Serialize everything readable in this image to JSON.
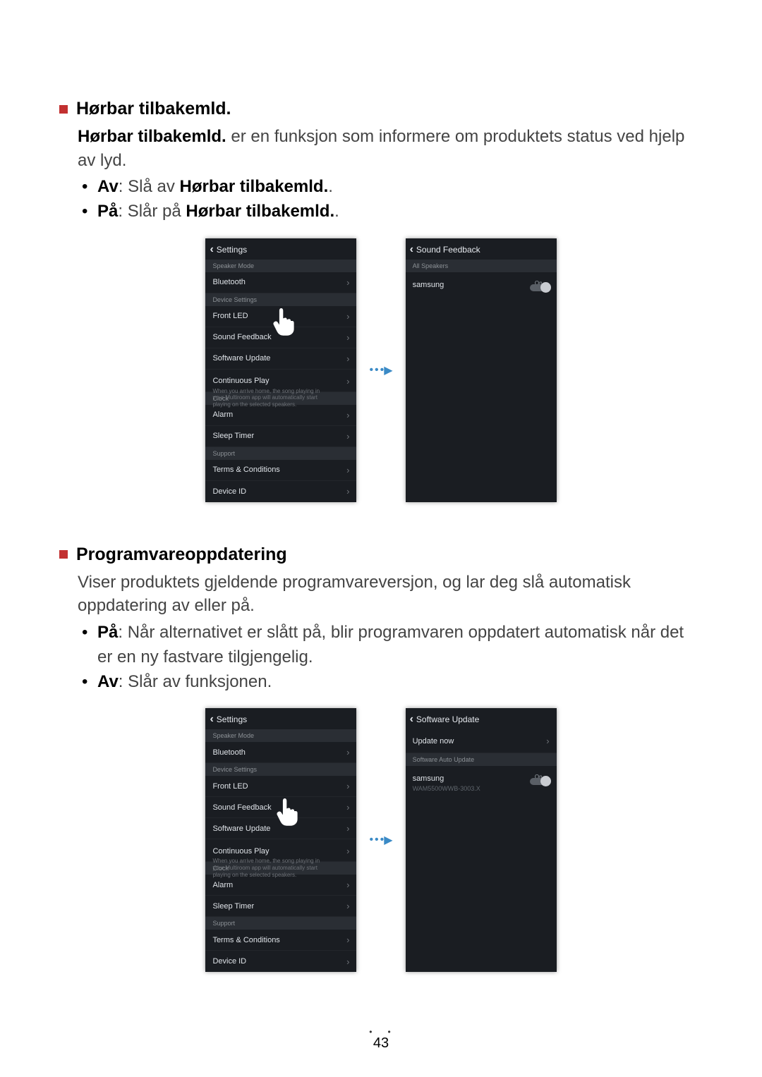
{
  "section1": {
    "heading": "Hørbar tilbakemld.",
    "intro_bold": "Hørbar tilbakemld.",
    "intro_rest": " er en funksjon som informere om produktets status ved hjelp av lyd.",
    "b1_label": "Av",
    "b1_text": ": Slå av ",
    "b1_bold2": "Hørbar tilbakemld.",
    "b1_end": ".",
    "b2_label": "På",
    "b2_text": ": Slår på ",
    "b2_bold2": "Hørbar tilbakemld.",
    "b2_end": "."
  },
  "section2": {
    "heading": "Programvareoppdatering",
    "intro": "Viser produktets gjeldende programvareversjon, og lar deg slå automatisk oppdatering av eller på.",
    "b1_label": "På",
    "b1_text": ": Når alternativet er slått på, blir programvaren oppdatert automatisk når det er en ny fastvare tilgjengelig.",
    "b2_label": "Av",
    "b2_text": ": Slår av funksjonen."
  },
  "settings": {
    "title": "Settings",
    "speaker_mode": "Speaker Mode",
    "bluetooth": "Bluetooth",
    "device_settings": "Device Settings",
    "front_led": "Front LED",
    "sound_feedback": "Sound Feedback",
    "software_update": "Software Update",
    "continuous_play": "Continuous Play",
    "continuous_desc": "When you arrive home, the song playing in your Multiroom app will automatically start playing on the selected speakers.",
    "clock": "Clock",
    "alarm": "Alarm",
    "sleep_timer": "Sleep Timer",
    "support": "Support",
    "terms": "Terms & Conditions",
    "device_id": "Device ID"
  },
  "sound_feedback_screen": {
    "title": "Sound Feedback",
    "all_speakers": "All Speakers",
    "speaker_name": "samsung",
    "toggle_label": "On"
  },
  "software_update_screen": {
    "title": "Software Update",
    "update_now": "Update now",
    "auto_update": "Software Auto Update",
    "speaker_name": "samsung",
    "version": "WAM5500WWB-3003.X",
    "toggle_label": "On"
  },
  "page_number": "43"
}
